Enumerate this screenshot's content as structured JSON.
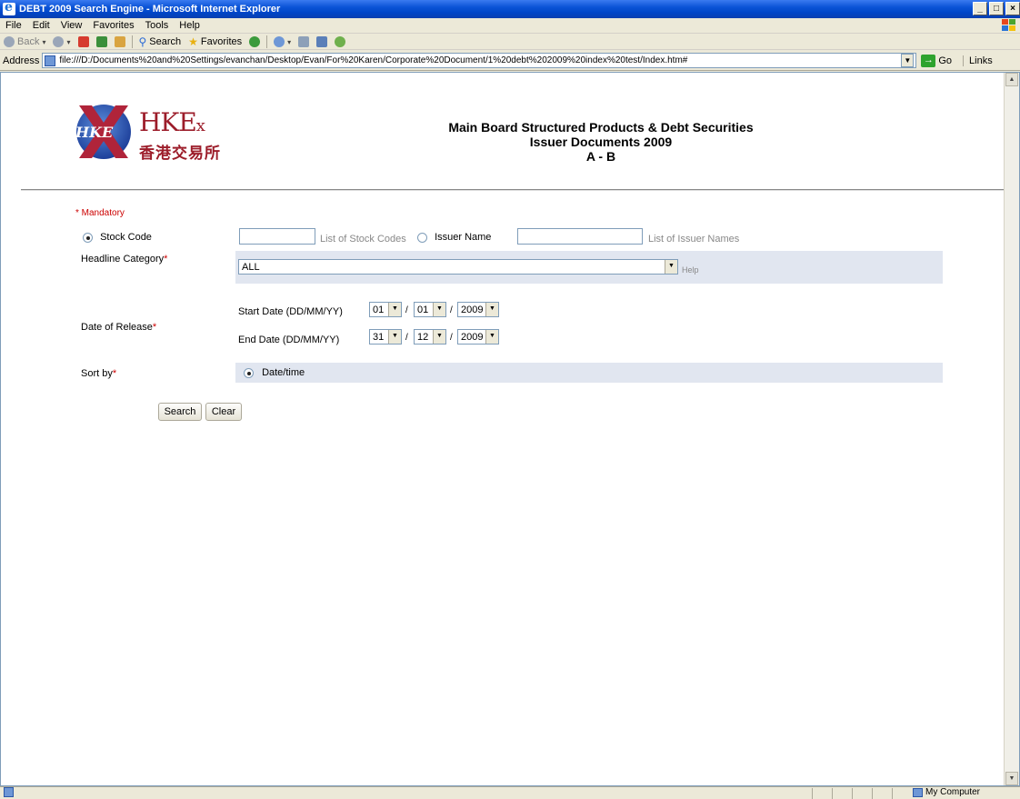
{
  "window": {
    "title": "DEBT 2009 Search Engine - Microsoft Internet Explorer",
    "buttons": [
      "_",
      "8",
      "x"
    ]
  },
  "menu": [
    "File",
    "Edit",
    "View",
    "Favorites",
    "Tools",
    "Help"
  ],
  "toolbar": {
    "back": "Back",
    "search": "Search",
    "favorites": "Favorites"
  },
  "address": {
    "label": "Address",
    "url": "file:///D:/Documents%20and%20Settings/evanchan/Desktop/Evan/For%20Karen/Corporate%20Document/1%20debt%202009%20index%20test/Index.htm#",
    "go": "Go",
    "links": "Links"
  },
  "header": {
    "logo_text": "HKE",
    "logo_suffix": "x",
    "logo_cn": "香港交易所",
    "emblem_text": "HKE",
    "title_line1": "Main Board Structured Products & Debt Securities",
    "title_line2": "Issuer Documents 2009",
    "title_line3": "A - B"
  },
  "form": {
    "mandatory": "* Mandatory",
    "stock_code_label": "Stock Code",
    "stock_code_value": "",
    "stock_code_list": "List of Stock Codes",
    "issuer_name_label": "Issuer Name",
    "issuer_name_value": "",
    "issuer_name_list": "List of Issuer Names",
    "search_by_selected": "stock_code",
    "headline_label": "Headline Category",
    "headline_value": "ALL",
    "help": "Help",
    "release_label": "Date of Release",
    "start_label": "Start Date (DD/MM/YY)",
    "end_label": "End Date (DD/MM/YY)",
    "start": {
      "dd": "01",
      "mm": "01",
      "yy": "2009"
    },
    "end": {
      "dd": "31",
      "mm": "12",
      "yy": "2009"
    },
    "date_sep": "/",
    "sort_label": "Sort by",
    "sort_value": "Date/time",
    "required_mark": "*",
    "search_button": "Search",
    "clear_button": "Clear"
  },
  "status": {
    "zone": "My Computer"
  },
  "colors": {
    "title_bar": "#0a53d6",
    "required": "#cc0000",
    "band": "#e1e6f0",
    "brand_red": "#9c1d2a"
  }
}
